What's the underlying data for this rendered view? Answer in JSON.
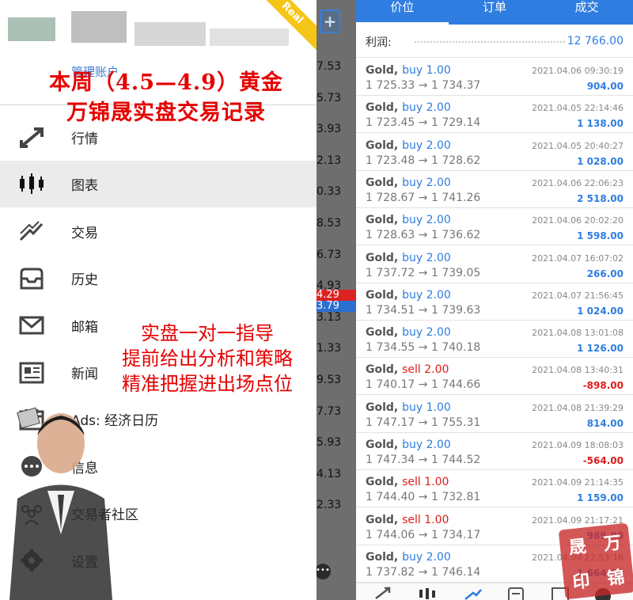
{
  "drawer": {
    "badge": "Real",
    "manage_account": "管理账户",
    "menu": [
      {
        "label": "行情",
        "icon": "quotes-icon"
      },
      {
        "label": "图表",
        "icon": "chart-icon"
      },
      {
        "label": "交易",
        "icon": "trade-icon"
      },
      {
        "label": "历史",
        "icon": "history-icon"
      },
      {
        "label": "邮箱",
        "icon": "mail-icon"
      },
      {
        "label": "新闻",
        "icon": "news-icon"
      },
      {
        "label": "Ads: 经济日历",
        "icon": "calendar-icon"
      },
      {
        "label": "信息",
        "icon": "message-icon"
      },
      {
        "label": "交易者社区",
        "icon": "community-icon"
      },
      {
        "label": "设置",
        "icon": "settings-icon"
      }
    ],
    "active_index": 1
  },
  "overlay": {
    "headline_line1": "本周（4.5—4.9）黄金",
    "headline_line2": "万锦晟实盘交易记录",
    "promo_line1": "实盘一对一指导",
    "promo_line2": "提前给出分析和策略",
    "promo_line3": "精准把握进出场点位"
  },
  "strip": {
    "numbers": [
      "7.53",
      "5.73",
      "3.93",
      "2.13",
      "0.33",
      "8.53",
      "6.73",
      "4.93",
      "3.13",
      "1.33",
      "9.53",
      "7.73",
      "5.93",
      "4.13",
      "2.33"
    ],
    "bid": "4.29",
    "ask": "3.79"
  },
  "panel": {
    "tabs": [
      "价位",
      "订单",
      "成交"
    ],
    "active_tab": 0,
    "profit_label": "利润:",
    "profit_value": "12 766.00",
    "trades": [
      {
        "symbol": "Gold,",
        "side": "buy 1.00",
        "type": "buy",
        "prices": "1 725.33 → 1 734.37",
        "time": "2021.04.06 09:30:19",
        "profit": "904.00"
      },
      {
        "symbol": "Gold,",
        "side": "buy 2.00",
        "type": "buy",
        "prices": "1 723.45 → 1 729.14",
        "time": "2021.04.05 22:14:46",
        "profit": "1 138.00"
      },
      {
        "symbol": "Gold,",
        "side": "buy 2.00",
        "type": "buy",
        "prices": "1 723.48 → 1 728.62",
        "time": "2021.04.05 20:40:27",
        "profit": "1 028.00"
      },
      {
        "symbol": "Gold,",
        "side": "buy 2.00",
        "type": "buy",
        "prices": "1 728.67 → 1 741.26",
        "time": "2021.04.06 22:06:23",
        "profit": "2 518.00"
      },
      {
        "symbol": "Gold,",
        "side": "buy 2.00",
        "type": "buy",
        "prices": "1 728.63 → 1 736.62",
        "time": "2021.04.06 20:02:20",
        "profit": "1 598.00"
      },
      {
        "symbol": "Gold,",
        "side": "buy 2.00",
        "type": "buy",
        "prices": "1 737.72 → 1 739.05",
        "time": "2021.04.07 16:07:02",
        "profit": "266.00"
      },
      {
        "symbol": "Gold,",
        "side": "buy 2.00",
        "type": "buy",
        "prices": "1 734.51 → 1 739.63",
        "time": "2021.04.07 21:56:45",
        "profit": "1 024.00"
      },
      {
        "symbol": "Gold,",
        "side": "buy 2.00",
        "type": "buy",
        "prices": "1 734.55 → 1 740.18",
        "time": "2021.04.08 13:01:08",
        "profit": "1 126.00"
      },
      {
        "symbol": "Gold,",
        "side": "sell 2.00",
        "type": "sell",
        "prices": "1 740.17 → 1 744.66",
        "time": "2021.04.08 13:40:31",
        "profit": "-898.00"
      },
      {
        "symbol": "Gold,",
        "side": "buy 1.00",
        "type": "buy",
        "prices": "1 747.17 → 1 755.31",
        "time": "2021.04.08 21:39:29",
        "profit": "814.00"
      },
      {
        "symbol": "Gold,",
        "side": "buy 2.00",
        "type": "buy",
        "prices": "1 747.34 → 1 744.52",
        "time": "2021.04.09 18:08:03",
        "profit": "-564.00"
      },
      {
        "symbol": "Gold,",
        "side": "sell 1.00",
        "type": "sell",
        "prices": "1 744.40 → 1 732.81",
        "time": "2021.04.09 21:14:35",
        "profit": "1 159.00"
      },
      {
        "symbol": "Gold,",
        "side": "sell 1.00",
        "type": "sell",
        "prices": "1 744.06 → 1 734.17",
        "time": "2021.04.09 21:17:21",
        "profit": "989.00"
      },
      {
        "symbol": "Gold,",
        "side": "buy 2.00",
        "type": "buy",
        "prices": "1 737.82 → 1 746.14",
        "time": "2021.04.09 22:53:16",
        "profit": "1 664.00"
      }
    ]
  },
  "seal": {
    "chars": [
      "晟",
      "万",
      "印",
      "锦"
    ]
  },
  "colors": {
    "accent": "#2f7de1",
    "sell": "#e01b1b",
    "headline": "#e60000"
  }
}
